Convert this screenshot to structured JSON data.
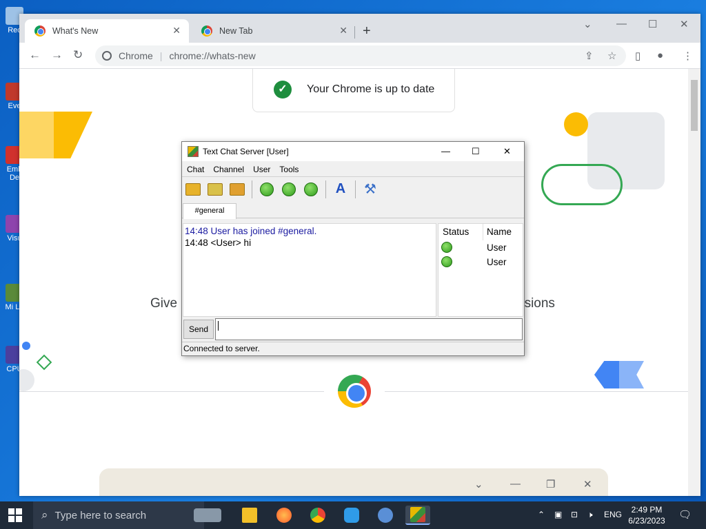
{
  "desktop": {
    "icons": [
      "Rec",
      "Eve",
      "Emb De",
      "Visu",
      "Mi La",
      "CPU"
    ]
  },
  "browser": {
    "tabs": [
      {
        "label": "What's New",
        "active": true
      },
      {
        "label": "New Tab",
        "active": false
      }
    ],
    "new_tab_label": "+",
    "site_label": "Chrome",
    "url": "chrome://whats-new",
    "update_status": "Your Chrome is up to date",
    "page_text_left": "Give",
    "page_text_right": "nsions"
  },
  "chat_app": {
    "title": "Text Chat Server [User]",
    "menu": [
      "Chat",
      "Channel",
      "User",
      "Tools"
    ],
    "channel_tab": "#general",
    "messages": [
      {
        "text": "14:48 User has joined #general.",
        "kind": "join"
      },
      {
        "text": "14:48 <User> hi",
        "kind": "chat"
      }
    ],
    "user_list": {
      "headers": {
        "status": "Status",
        "name": "Name"
      },
      "users": [
        {
          "name": "User",
          "status_icon": "online-smiley-icon"
        },
        {
          "name": "User",
          "status_icon": "online-smiley-icon"
        }
      ]
    },
    "send_label": "Send",
    "input_value": "",
    "status_text": "Connected to server."
  },
  "taskbar": {
    "search_placeholder": "Type here to search",
    "language": "ENG",
    "time": "2:49 PM",
    "date": "6/23/2023"
  },
  "colors": {
    "taskbar": "#1f2a38",
    "chrome_tabstrip": "#dee1e6",
    "check_green": "#1e8e3e",
    "join_msg": "#1a1aa0"
  }
}
